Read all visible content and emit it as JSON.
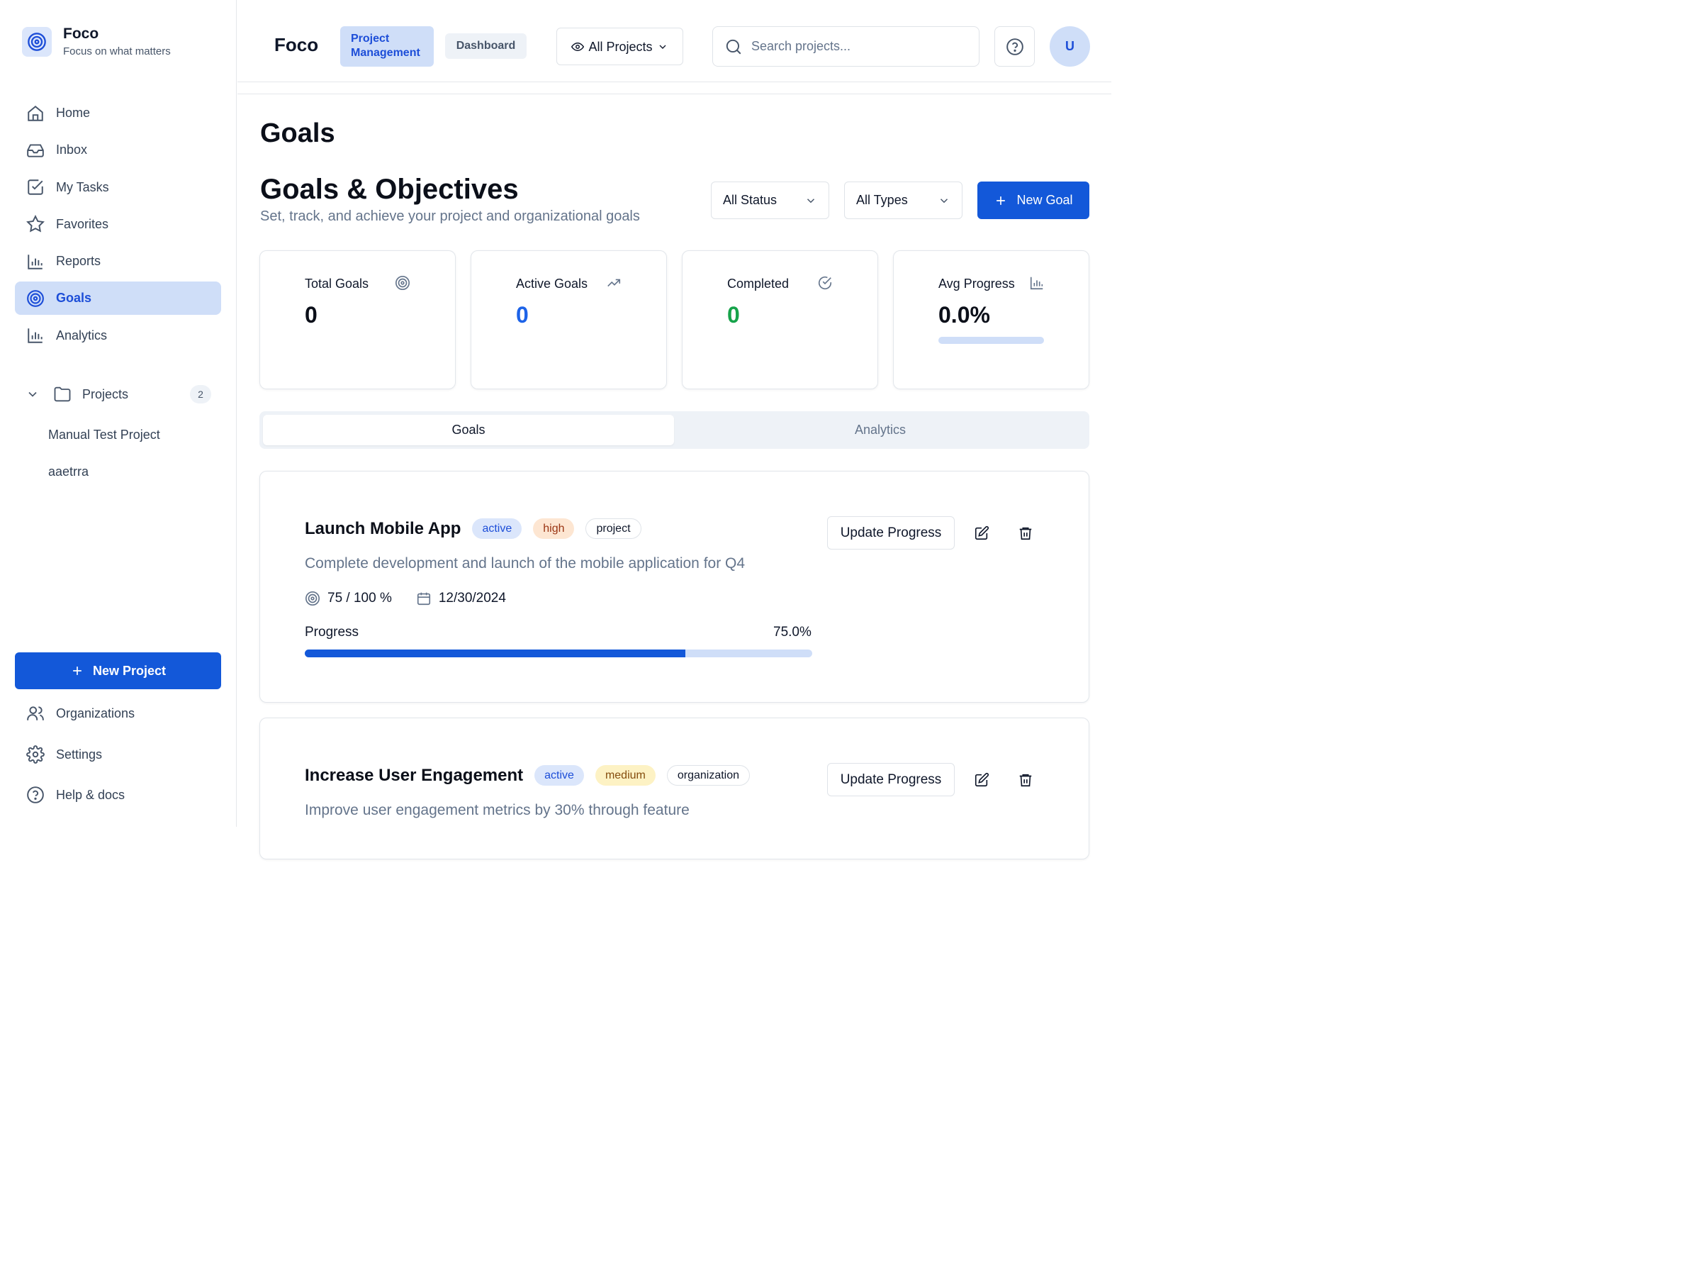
{
  "brand": {
    "name": "Foco",
    "tagline": "Focus on what matters"
  },
  "sidebar": {
    "items": [
      {
        "label": "Home",
        "icon": "home-icon"
      },
      {
        "label": "Inbox",
        "icon": "inbox-icon"
      },
      {
        "label": "My Tasks",
        "icon": "check-square-icon"
      },
      {
        "label": "Favorites",
        "icon": "star-icon"
      },
      {
        "label": "Reports",
        "icon": "bar-chart-icon"
      },
      {
        "label": "Goals",
        "icon": "target-icon",
        "active": true
      },
      {
        "label": "Analytics",
        "icon": "bar-chart-icon"
      }
    ],
    "projects": {
      "label": "Projects",
      "count": "2",
      "items": [
        "Manual Test Project",
        "aaetrra"
      ]
    },
    "new_project_label": "New Project",
    "bottom": [
      {
        "label": "Organizations",
        "icon": "users-icon"
      },
      {
        "label": "Settings",
        "icon": "gear-icon"
      },
      {
        "label": "Help & docs",
        "icon": "help-circle-icon"
      }
    ]
  },
  "header": {
    "title": "Foco",
    "pill_project_management": "Project Management",
    "pill_dashboard": "Dashboard",
    "project_select": "All Projects",
    "search_placeholder": "Search projects...",
    "avatar_initial": "U"
  },
  "page": {
    "title": "Goals",
    "section_title": "Goals & Objectives",
    "section_subtitle": "Set, track, and achieve your project and organizational goals",
    "filters": {
      "status": "All Status",
      "type": "All Types"
    },
    "new_goal_label": "New Goal"
  },
  "stats": [
    {
      "label": "Total Goals",
      "value": "0",
      "icon": "target-icon",
      "color": "#0b0f19"
    },
    {
      "label": "Active Goals",
      "value": "0",
      "icon": "trending-up-icon",
      "color": "#1d63e8"
    },
    {
      "label": "Completed",
      "value": "0",
      "icon": "check-circle-icon",
      "color": "#16a34a"
    },
    {
      "label": "Avg Progress",
      "value": "0.0%",
      "icon": "bar-chart-icon",
      "color": "#0b0f19",
      "progress": 0
    }
  ],
  "tabs": [
    {
      "label": "Goals",
      "active": true
    },
    {
      "label": "Analytics",
      "active": false
    }
  ],
  "goals": [
    {
      "title": "Launch Mobile App",
      "status": "active",
      "priority": "high",
      "type": "project",
      "description": "Complete development and launch of the mobile application for Q4",
      "target": "75 / 100 %",
      "due": "12/30/2024",
      "progress_label": "Progress",
      "progress_text": "75.0%",
      "progress": 0.75,
      "update_label": "Update Progress"
    },
    {
      "title": "Increase User Engagement",
      "status": "active",
      "priority": "medium",
      "type": "organization",
      "description": "Improve user engagement metrics by 30% through feature",
      "update_label": "Update Progress"
    }
  ],
  "colors": {
    "accent": "#1358d9",
    "accent_light": "#cfdef8",
    "success": "#16a34a"
  }
}
